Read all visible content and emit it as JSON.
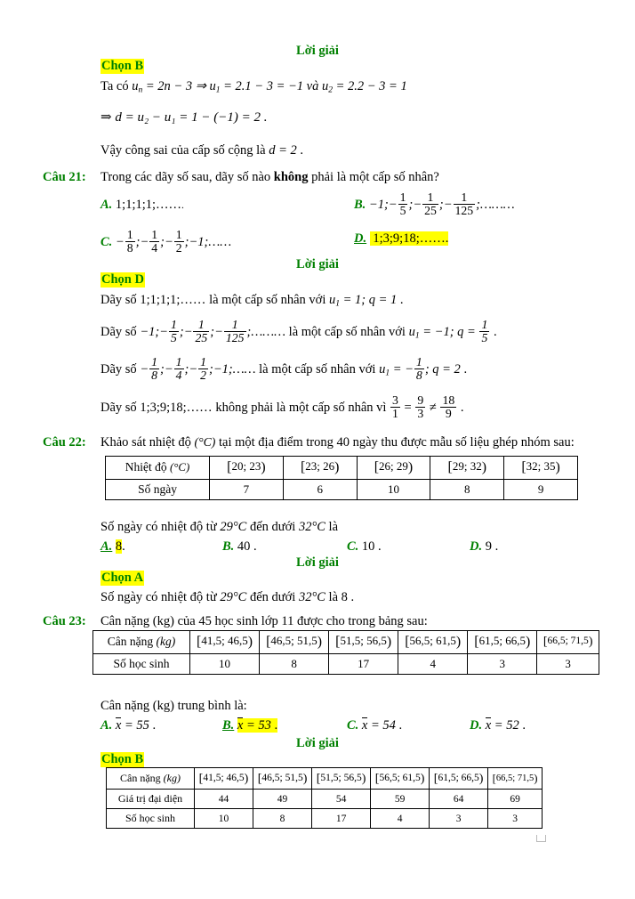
{
  "labels": {
    "loigiai": "Lời giải",
    "chon_b": "Chọn B",
    "chon_d": "Chọn D",
    "chon_a": "Chọn A",
    "chon_b2": "Chọn B"
  },
  "cau20_solution": {
    "line1_prefix": "Ta có ",
    "line1_math_a": "u",
    "line1_math_a_sub": "n",
    "line1_math_b": " = 2n − 3 ⇒ ",
    "line1_math_c": "u",
    "line1_math_c_sub": "1",
    "line1_math_d": " = 2.1 − 3 = −1 và ",
    "line1_math_e": "u",
    "line1_math_e_sub": "2",
    "line1_math_f": " = 2.2 − 3 = 1",
    "line2": "⇒ d = u₂ − u₁ = 1 − (−1) = 2 .",
    "line3_prefix": "Vậy công sai của cấp số cộng là ",
    "line3_math": "d = 2",
    "line3_suffix": " ."
  },
  "cau21": {
    "number": "Câu 21:",
    "prompt_pre": "Trong các dãy số sau, dãy số nào ",
    "prompt_bold": "không",
    "prompt_post": " phải là một cấp số nhân?",
    "options": [
      {
        "letter": "A.",
        "text": "1;1;1;1;……"
      },
      {
        "letter": "B.",
        "text": "−1; −1/5; −1/25; −1/125;………"
      },
      {
        "letter": "C.",
        "text": "−1/8; −1/4; −1/2; −1;……"
      },
      {
        "letter": "D.",
        "text": "1;3;9;18;……."
      }
    ],
    "correct": "D",
    "solution": {
      "l1_a": "Dãy số ",
      "l1_b": "1;1;1;1;……",
      "l1_c": " là một cấp số nhân với ",
      "l1_d": "u₁ = 1; q = 1",
      "l1_e": " .",
      "l2_a": "Dãy số ",
      "l2_c": " là một cấp số nhân với ",
      "l2_d": "u₁ = −1; q = 1/5",
      "l2_e": " .",
      "l3_a": "Dãy số ",
      "l3_c": " là một cấp số nhân với ",
      "l3_d": "u₁ = −1/8; q = 2",
      "l3_e": " .",
      "l4_a": "Dãy số ",
      "l4_b": "1;3;9;18;……",
      "l4_c": " không phải là một cấp số nhân vì ",
      "l4_d": "3/1 = 9/3 ≠ 18/9",
      "l4_e": " ."
    }
  },
  "cau22": {
    "number": "Câu 22:",
    "prompt_a": "Khảo sát nhiệt độ ",
    "prompt_unit": "(°C)",
    "prompt_b": " tại một địa điểm trong ",
    "prompt_n": "40",
    "prompt_c": " ngày thu được mẫu số liệu ghép nhóm sau:",
    "table": {
      "row_header_label": "Nhiệt độ (°C)",
      "row_count_label": "Số ngày",
      "intervals": [
        "[20; 23)",
        "[23; 26)",
        "[26; 29)",
        "[29; 32)",
        "[32; 35)"
      ],
      "counts": [
        "7",
        "6",
        "10",
        "8",
        "9"
      ]
    },
    "question": "Số ngày có nhiệt độ từ 29°C đến dưới 32°C là",
    "options": [
      {
        "letter": "A.",
        "text": "8"
      },
      {
        "letter": "B.",
        "text": "40"
      },
      {
        "letter": "C.",
        "text": "10"
      },
      {
        "letter": "D.",
        "text": "9"
      }
    ],
    "correct": "A",
    "solution_text_pre": "Số ngày có nhiệt độ từ 29°C đến dưới 32°C là 8 ."
  },
  "cau23": {
    "number": "Câu 23:",
    "prompt_a": "Cân nặng (kg) của ",
    "prompt_n": "45",
    "prompt_b": " học sinh lớp 11 được cho trong bảng sau:",
    "table": {
      "row_header_label": "Cân nặng (kg)",
      "row_count_label": "Số học sinh",
      "intervals": [
        "[41,5; 46,5)",
        "[46,5; 51,5)",
        "[51,5; 56,5)",
        "[56,5; 61,5)",
        "[61,5; 66,5)",
        "[66,5; 71,5)"
      ],
      "counts": [
        "10",
        "8",
        "17",
        "4",
        "3",
        "3"
      ]
    },
    "question": "Cân nặng (kg) trung bình là:",
    "options": [
      {
        "letter": "A.",
        "value": "= 55"
      },
      {
        "letter": "B.",
        "value": "= 53"
      },
      {
        "letter": "C.",
        "value": "= 54"
      },
      {
        "letter": "D.",
        "value": "= 52"
      }
    ],
    "xbar": "x",
    "correct": "B",
    "solution_table": {
      "row_header_label": "Cân nặng (kg)",
      "row_mid_label": "Giá trị đại diện",
      "row_count_label": "Số học sinh",
      "intervals": [
        "[41,5; 46,5)",
        "[46,5; 51,5)",
        "[51,5; 56,5)",
        "[56,5; 61,5)",
        "[61,5; 66,5)",
        "[66,5; 71,5)"
      ],
      "midpoints": [
        "44",
        "49",
        "54",
        "59",
        "64",
        "69"
      ],
      "counts": [
        "10",
        "8",
        "17",
        "4",
        "3",
        "3"
      ]
    }
  },
  "colors": {
    "green": "#008000",
    "highlight": "#ffff00",
    "text": "#000000"
  }
}
